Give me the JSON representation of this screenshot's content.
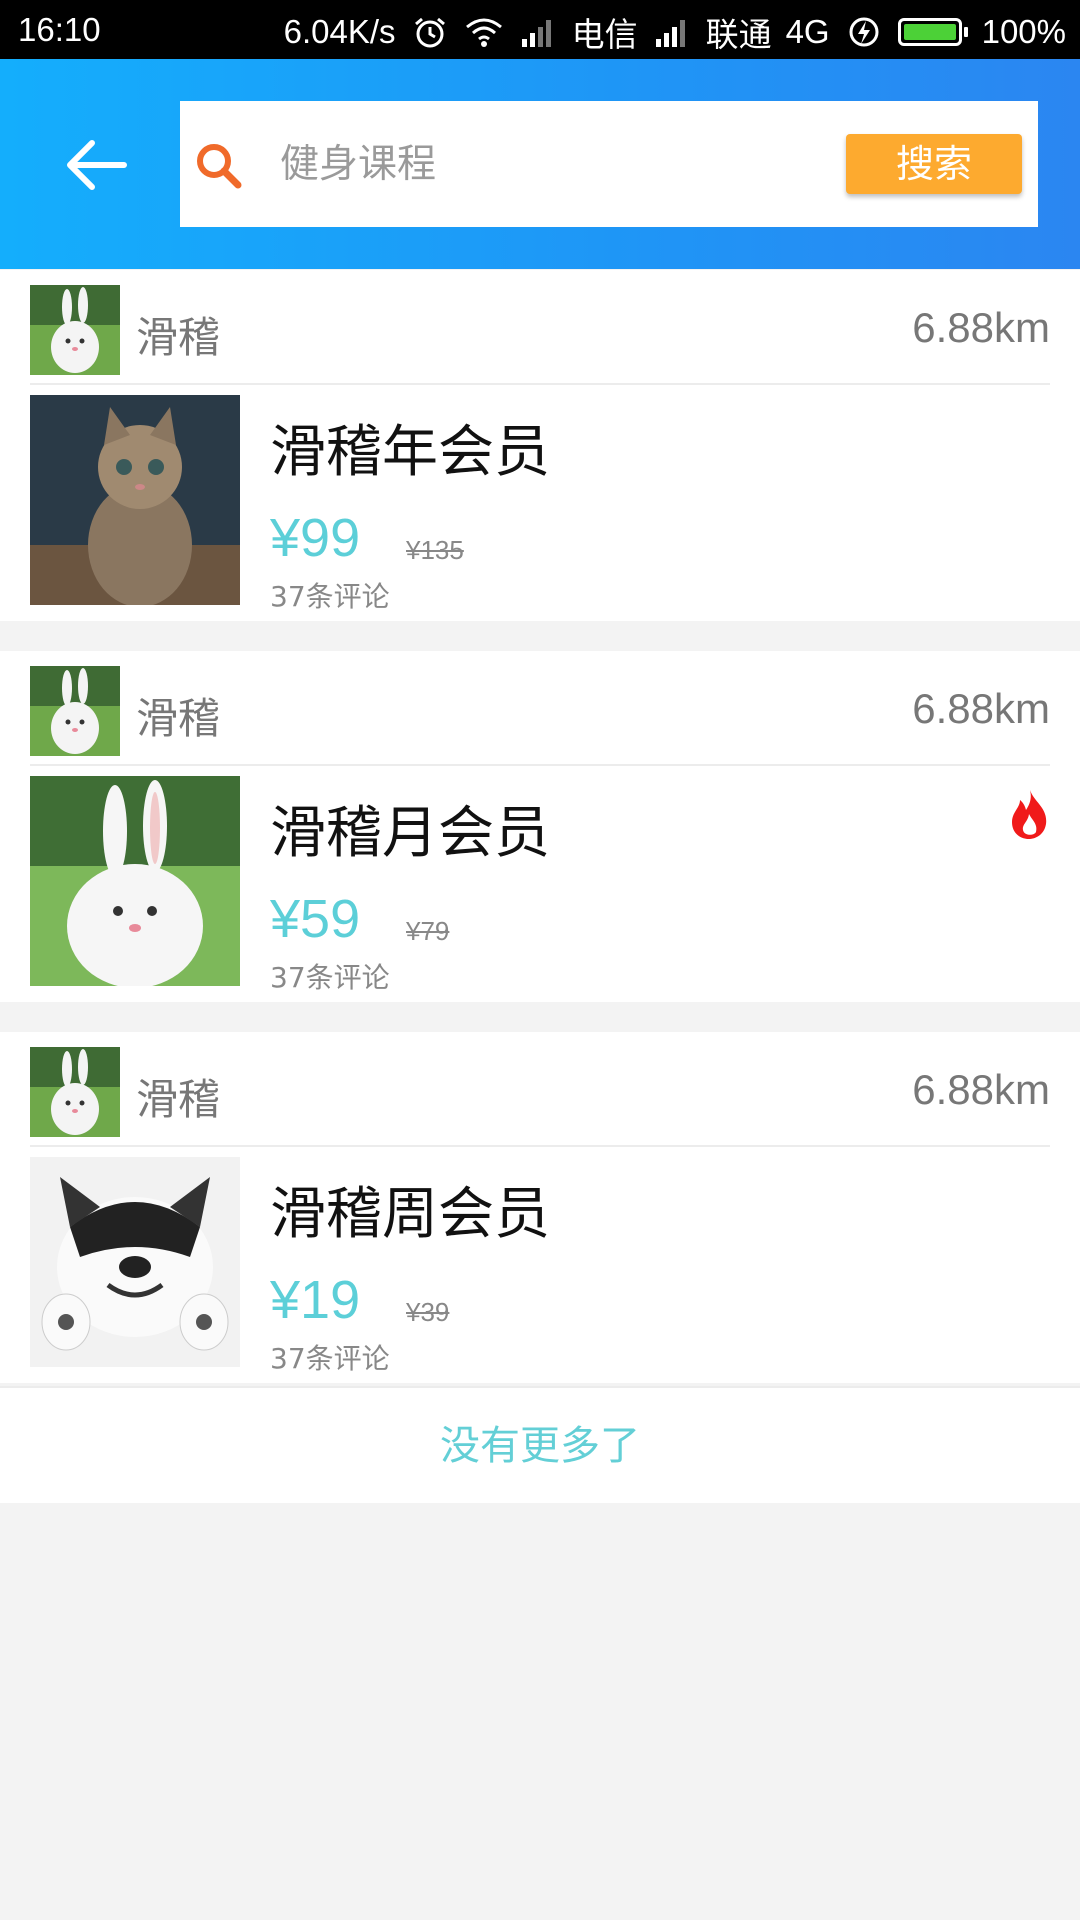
{
  "status_bar": {
    "time": "16:10",
    "net_speed": "6.04K/s",
    "carrier1": "电信",
    "carrier2": "联通",
    "network": "4G",
    "battery": "100%"
  },
  "header": {
    "search_placeholder": "健身课程",
    "search_button": "搜索"
  },
  "items": [
    {
      "shop": "滑稽",
      "distance": "6.88km",
      "title": "滑稽年会员",
      "price": "¥99",
      "original_price": "¥135",
      "comments": "37条评论",
      "hot": false,
      "thumb": "cat-photo"
    },
    {
      "shop": "滑稽",
      "distance": "6.88km",
      "title": "滑稽月会员",
      "price": "¥59",
      "original_price": "¥79",
      "comments": "37条评论",
      "hot": true,
      "thumb": "rabbit-photo"
    },
    {
      "shop": "滑稽",
      "distance": "6.88km",
      "title": "滑稽周会员",
      "price": "¥19",
      "original_price": "¥39",
      "comments": "37条评论",
      "hot": false,
      "thumb": "husky-photo"
    }
  ],
  "footer": {
    "no_more": "没有更多了"
  },
  "colors": {
    "header_start": "#14aefc",
    "header_end": "#2b86f1",
    "search_button": "#fdaa2f",
    "price": "#5ccfd8",
    "hot": "#f01a1a"
  }
}
